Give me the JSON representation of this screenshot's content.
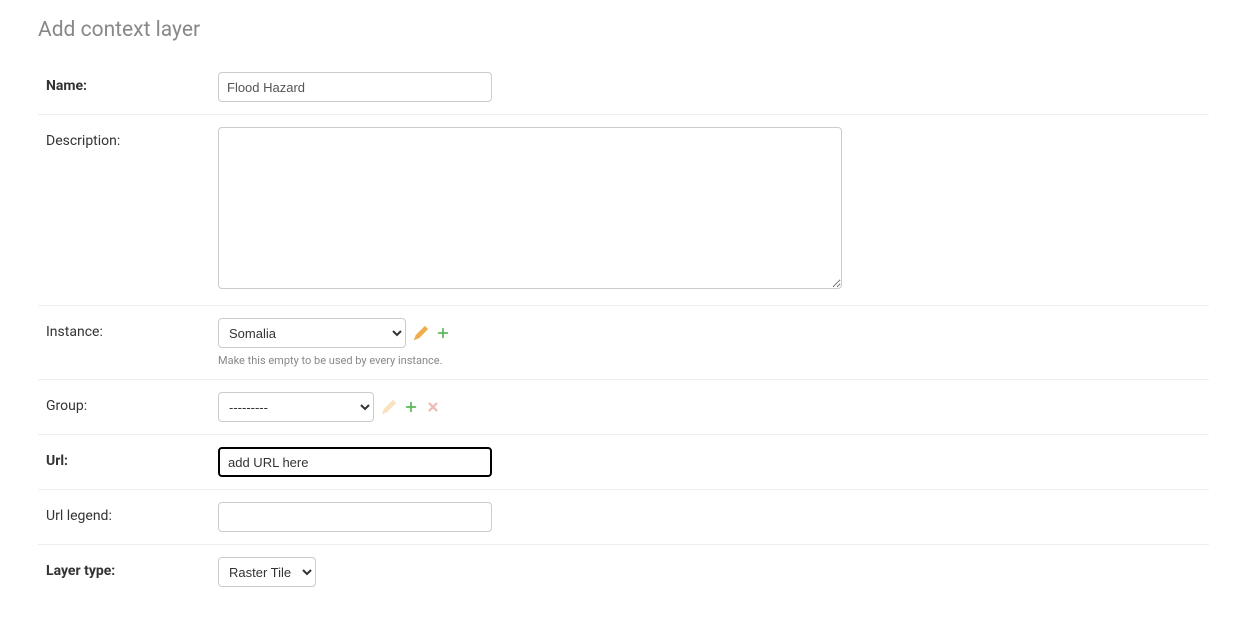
{
  "page_title": "Add context layer",
  "fields": {
    "name": {
      "label": "Name:",
      "value": "Flood Hazard"
    },
    "description": {
      "label": "Description:",
      "value": ""
    },
    "instance": {
      "label": "Instance:",
      "selected": "Somalia",
      "help": "Make this empty to be used by every instance."
    },
    "group": {
      "label": "Group:",
      "selected": "---------"
    },
    "url": {
      "label": "Url:",
      "value": "add URL here"
    },
    "url_legend": {
      "label": "Url legend:",
      "value": ""
    },
    "layer_type": {
      "label": "Layer type:",
      "selected": "Raster Tile"
    }
  },
  "colors": {
    "edit_icon": "#f0ad4e",
    "add_icon": "#5cb85c",
    "edit_icon_faded": "#f5deb3",
    "delete_icon_faded": "#f5c6cb"
  }
}
